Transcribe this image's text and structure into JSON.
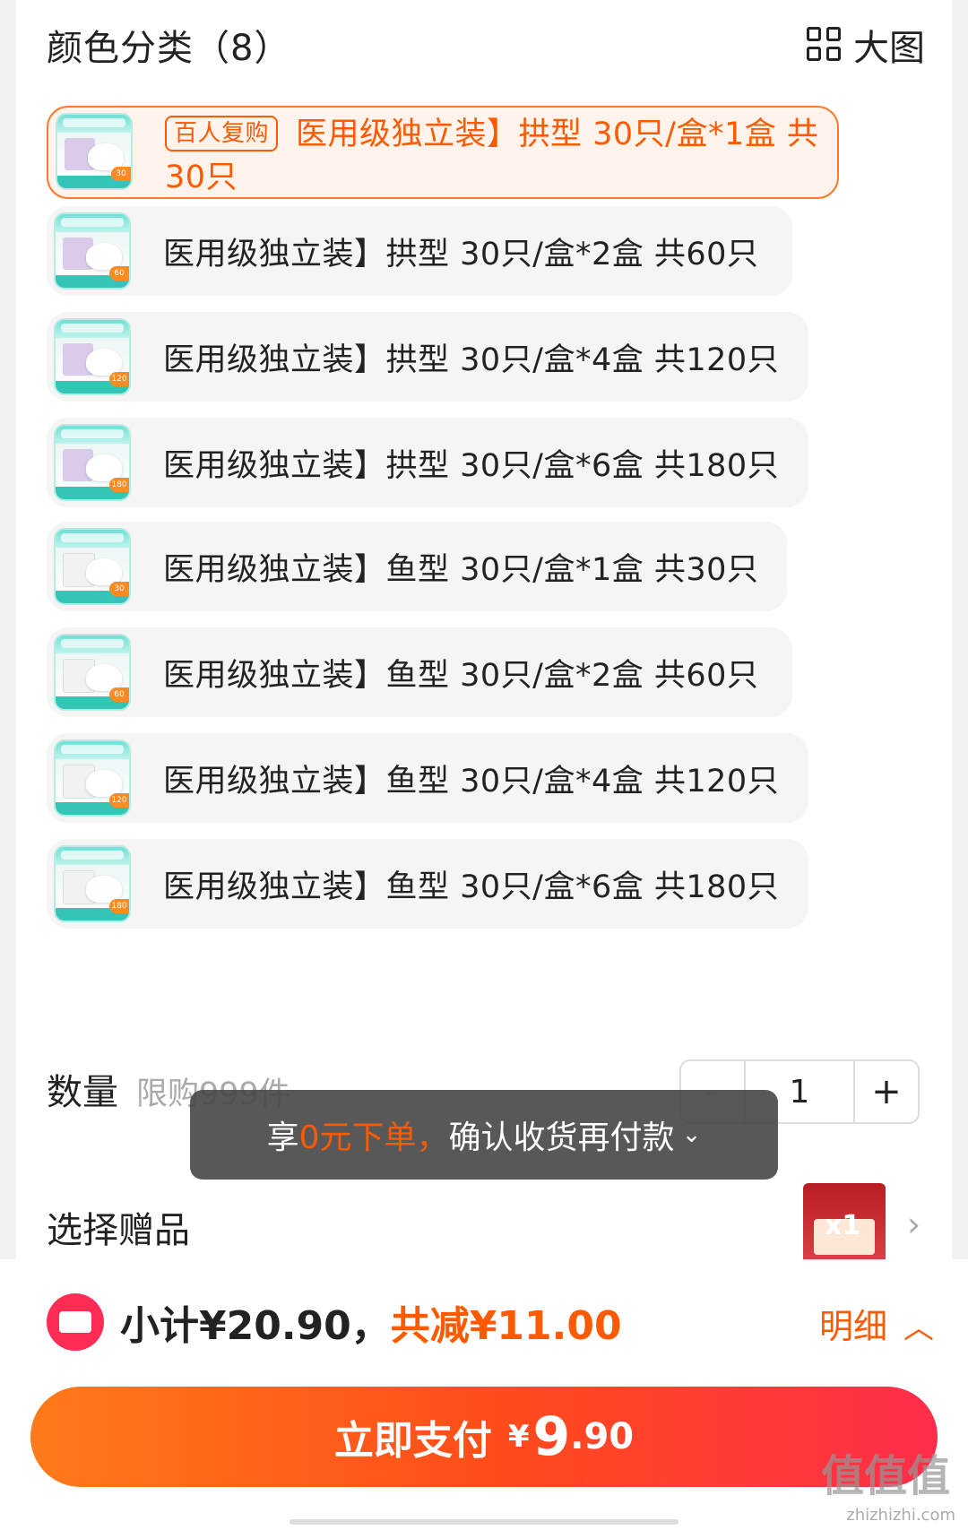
{
  "sku": {
    "title": "颜色分类（8）",
    "view_toggle": "大图",
    "options": [
      {
        "badge": "百人复购",
        "label": "医用级独立装】拱型 30只/盒*1盒 共30只",
        "thumb_tag": "30",
        "style": "arch",
        "selected": true
      },
      {
        "label": "医用级独立装】拱型 30只/盒*2盒 共60只",
        "thumb_tag": "60",
        "style": "arch"
      },
      {
        "label": "医用级独立装】拱型 30只/盒*4盒 共120只",
        "thumb_tag": "120",
        "style": "arch"
      },
      {
        "label": "医用级独立装】拱型 30只/盒*6盒 共180只",
        "thumb_tag": "180",
        "style": "arch"
      },
      {
        "label": "医用级独立装】鱼型 30只/盒*1盒 共30只",
        "thumb_tag": "30",
        "style": "fish"
      },
      {
        "label": "医用级独立装】鱼型 30只/盒*2盒 共60只",
        "thumb_tag": "60",
        "style": "fish"
      },
      {
        "label": "医用级独立装】鱼型 30只/盒*4盒 共120只",
        "thumb_tag": "120",
        "style": "fish"
      },
      {
        "label": "医用级独立装】鱼型 30只/盒*6盒 共180只",
        "thumb_tag": "180",
        "style": "fish"
      }
    ]
  },
  "quantity": {
    "label": "数量",
    "limit": "限购999件",
    "minus": "-",
    "value": "1",
    "plus": "+"
  },
  "toast": {
    "prefix": "享",
    "highlight": "0元下单，",
    "suffix": "确认收货再付款"
  },
  "gift": {
    "label": "选择赠品",
    "qty": "x1"
  },
  "summary": {
    "subtotal": "小计¥20.90，",
    "discount": "共减¥11.00",
    "detail": "明细"
  },
  "pay": {
    "label": "立即支付",
    "currency": "¥",
    "integer": "9",
    "decimal": ".90"
  },
  "watermark": {
    "text": "值值值",
    "sub": "zhizhizhi.com"
  },
  "colors": {
    "accent": "#ff5a00",
    "selected_bg": "#fff3ec",
    "toast_bg": "#464646"
  }
}
